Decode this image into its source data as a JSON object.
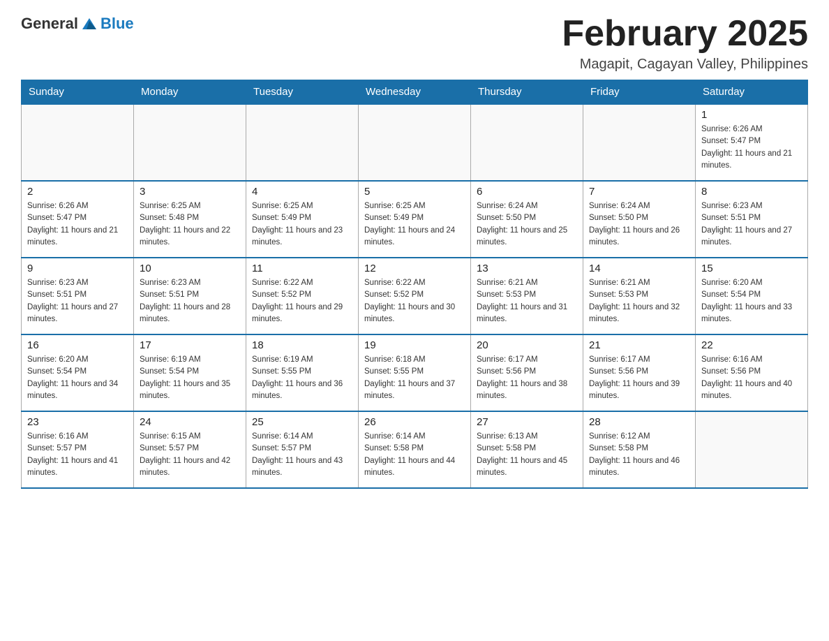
{
  "header": {
    "logo_general": "General",
    "logo_blue": "Blue",
    "month_title": "February 2025",
    "location": "Magapit, Cagayan Valley, Philippines"
  },
  "weekdays": [
    "Sunday",
    "Monday",
    "Tuesday",
    "Wednesday",
    "Thursday",
    "Friday",
    "Saturday"
  ],
  "weeks": [
    [
      {
        "day": "",
        "info": ""
      },
      {
        "day": "",
        "info": ""
      },
      {
        "day": "",
        "info": ""
      },
      {
        "day": "",
        "info": ""
      },
      {
        "day": "",
        "info": ""
      },
      {
        "day": "",
        "info": ""
      },
      {
        "day": "1",
        "info": "Sunrise: 6:26 AM\nSunset: 5:47 PM\nDaylight: 11 hours and 21 minutes."
      }
    ],
    [
      {
        "day": "2",
        "info": "Sunrise: 6:26 AM\nSunset: 5:47 PM\nDaylight: 11 hours and 21 minutes."
      },
      {
        "day": "3",
        "info": "Sunrise: 6:25 AM\nSunset: 5:48 PM\nDaylight: 11 hours and 22 minutes."
      },
      {
        "day": "4",
        "info": "Sunrise: 6:25 AM\nSunset: 5:49 PM\nDaylight: 11 hours and 23 minutes."
      },
      {
        "day": "5",
        "info": "Sunrise: 6:25 AM\nSunset: 5:49 PM\nDaylight: 11 hours and 24 minutes."
      },
      {
        "day": "6",
        "info": "Sunrise: 6:24 AM\nSunset: 5:50 PM\nDaylight: 11 hours and 25 minutes."
      },
      {
        "day": "7",
        "info": "Sunrise: 6:24 AM\nSunset: 5:50 PM\nDaylight: 11 hours and 26 minutes."
      },
      {
        "day": "8",
        "info": "Sunrise: 6:23 AM\nSunset: 5:51 PM\nDaylight: 11 hours and 27 minutes."
      }
    ],
    [
      {
        "day": "9",
        "info": "Sunrise: 6:23 AM\nSunset: 5:51 PM\nDaylight: 11 hours and 27 minutes."
      },
      {
        "day": "10",
        "info": "Sunrise: 6:23 AM\nSunset: 5:51 PM\nDaylight: 11 hours and 28 minutes."
      },
      {
        "day": "11",
        "info": "Sunrise: 6:22 AM\nSunset: 5:52 PM\nDaylight: 11 hours and 29 minutes."
      },
      {
        "day": "12",
        "info": "Sunrise: 6:22 AM\nSunset: 5:52 PM\nDaylight: 11 hours and 30 minutes."
      },
      {
        "day": "13",
        "info": "Sunrise: 6:21 AM\nSunset: 5:53 PM\nDaylight: 11 hours and 31 minutes."
      },
      {
        "day": "14",
        "info": "Sunrise: 6:21 AM\nSunset: 5:53 PM\nDaylight: 11 hours and 32 minutes."
      },
      {
        "day": "15",
        "info": "Sunrise: 6:20 AM\nSunset: 5:54 PM\nDaylight: 11 hours and 33 minutes."
      }
    ],
    [
      {
        "day": "16",
        "info": "Sunrise: 6:20 AM\nSunset: 5:54 PM\nDaylight: 11 hours and 34 minutes."
      },
      {
        "day": "17",
        "info": "Sunrise: 6:19 AM\nSunset: 5:54 PM\nDaylight: 11 hours and 35 minutes."
      },
      {
        "day": "18",
        "info": "Sunrise: 6:19 AM\nSunset: 5:55 PM\nDaylight: 11 hours and 36 minutes."
      },
      {
        "day": "19",
        "info": "Sunrise: 6:18 AM\nSunset: 5:55 PM\nDaylight: 11 hours and 37 minutes."
      },
      {
        "day": "20",
        "info": "Sunrise: 6:17 AM\nSunset: 5:56 PM\nDaylight: 11 hours and 38 minutes."
      },
      {
        "day": "21",
        "info": "Sunrise: 6:17 AM\nSunset: 5:56 PM\nDaylight: 11 hours and 39 minutes."
      },
      {
        "day": "22",
        "info": "Sunrise: 6:16 AM\nSunset: 5:56 PM\nDaylight: 11 hours and 40 minutes."
      }
    ],
    [
      {
        "day": "23",
        "info": "Sunrise: 6:16 AM\nSunset: 5:57 PM\nDaylight: 11 hours and 41 minutes."
      },
      {
        "day": "24",
        "info": "Sunrise: 6:15 AM\nSunset: 5:57 PM\nDaylight: 11 hours and 42 minutes."
      },
      {
        "day": "25",
        "info": "Sunrise: 6:14 AM\nSunset: 5:57 PM\nDaylight: 11 hours and 43 minutes."
      },
      {
        "day": "26",
        "info": "Sunrise: 6:14 AM\nSunset: 5:58 PM\nDaylight: 11 hours and 44 minutes."
      },
      {
        "day": "27",
        "info": "Sunrise: 6:13 AM\nSunset: 5:58 PM\nDaylight: 11 hours and 45 minutes."
      },
      {
        "day": "28",
        "info": "Sunrise: 6:12 AM\nSunset: 5:58 PM\nDaylight: 11 hours and 46 minutes."
      },
      {
        "day": "",
        "info": ""
      }
    ]
  ]
}
